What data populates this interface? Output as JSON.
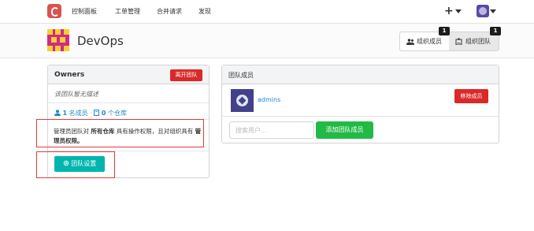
{
  "nav": {
    "items": [
      "控制面板",
      "工单管理",
      "合并请求",
      "发现"
    ],
    "plus_glyph": "+"
  },
  "org": {
    "name": "DevOps",
    "members_label": "组织成员",
    "members_count": "1",
    "teams_label": "组织团队",
    "teams_count": "1"
  },
  "owners": {
    "title": "Owners",
    "leave_button": "离开团队",
    "description": "该团队暂无描述",
    "member_count": "1",
    "member_unit": "名成员",
    "separator": "·",
    "repo_count": "0",
    "repo_unit": "个仓库",
    "perm_part1": "管理员团队对 ",
    "perm_bold1": "所有仓库",
    "perm_part2": " 具有操作权限，且对组织具有 ",
    "perm_bold2": "管理员权限。",
    "settings_button": "团队设置"
  },
  "members": {
    "title": "团队成员",
    "list": [
      {
        "name": "admins",
        "remove_label": "移除成员"
      }
    ],
    "search_placeholder": "搜索用户...",
    "add_button": "添加团队成员"
  },
  "colors": {
    "danger": "#db2828",
    "teal": "#00b5ad",
    "green": "#21ba45",
    "link": "#2185d0",
    "annotation": "#e33a3a"
  }
}
